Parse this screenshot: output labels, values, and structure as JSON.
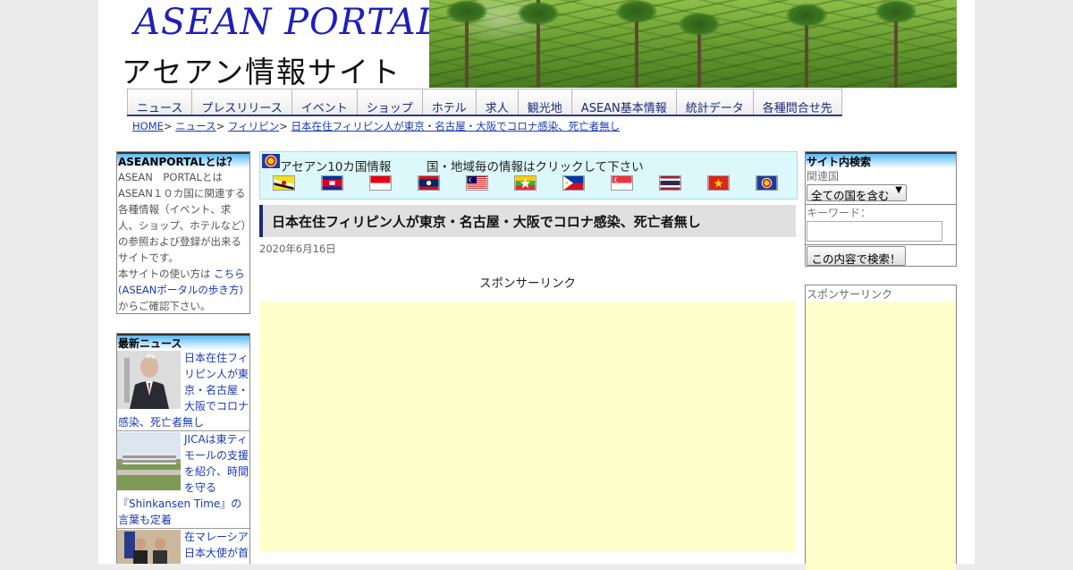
{
  "header": {
    "logo_en": "ASEAN PORTAL",
    "logo_jp": "アセアン情報サイト"
  },
  "nav": {
    "items": [
      "ニュース",
      "プレスリリース",
      "イベント",
      "ショップ",
      "ホテル",
      "求人",
      "観光地",
      "ASEAN基本情報",
      "統計データ",
      "各種問合せ先"
    ]
  },
  "breadcrumb": {
    "home": "HOME",
    "news": "ニュース",
    "country": "フィリピン",
    "current": "日本在住フィリピン人が東京・名古屋・大阪でコロナ感染、死亡者無し",
    "separator": ">"
  },
  "about": {
    "title": "ASEANPORTALとは？",
    "text": "ASEAN　PORTALとはASEAN１０カ国に関連する各種情報（イベント、求人、ショップ、ホテルなど）の参照および登録が出来るサイトです。",
    "guide_prefix": "本サイトの使い方は",
    "guide_link": "こちら(ASEANポータルの歩き方)",
    "guide_suffix": "からご確認下さい。"
  },
  "latest_news": {
    "title": "最新ニュース",
    "items": [
      {
        "text": "日本在住フィリピン人が東京・名古屋・大阪でコロナ感染、死亡者無し"
      },
      {
        "text": "JICAは東ティモールの支援を紹介、時間を守る『Shinkansen Time』の言葉も定着"
      },
      {
        "text": "在マレーシア日本大使が首"
      }
    ]
  },
  "countries": {
    "title": "アセアン10カ国情報",
    "note": "国・地域毎の情報はクリックして下さい"
  },
  "article": {
    "title": "日本在住フィリピン人が東京・名古屋・大阪でコロナ感染、死亡者無し",
    "date": "2020年6月16日",
    "sponsor_label": "スポンサーリンク"
  },
  "search": {
    "title": "サイト内検索",
    "country_label": "関連国",
    "country_selected": "全ての国を含む",
    "keyword_label": "キーワード：",
    "keyword_value": "",
    "submit_label": "この内容で検索！"
  },
  "right_ad": {
    "sponsor_label": "スポンサーリンク"
  },
  "colors": {
    "logo_blue": "#1d20b8",
    "link_blue": "#1a3bb5",
    "nav_underline": "#2b3a8f",
    "ad_background": "#ffffcc",
    "country_bar": "#ddf8fb"
  }
}
